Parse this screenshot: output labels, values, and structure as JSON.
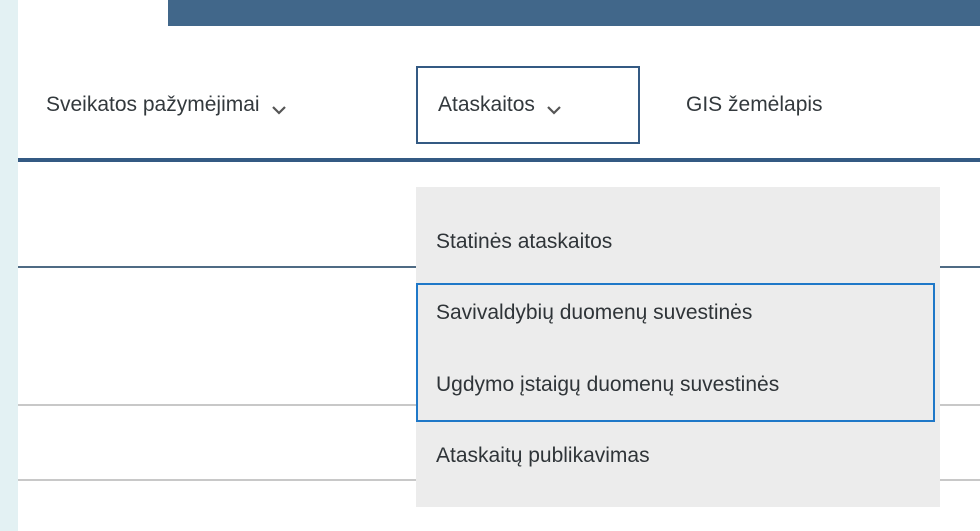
{
  "nav": {
    "items": [
      {
        "label": "Sveikatos pažymėjimai",
        "has_dropdown": true,
        "icon": "chevron-down-icon"
      },
      {
        "label": "Ataskaitos",
        "has_dropdown": true,
        "icon": "chevron-down-icon",
        "state": "open"
      },
      {
        "label": "GIS žemėlapis",
        "has_dropdown": false
      }
    ]
  },
  "dropdown": {
    "parent": "Ataskaitos",
    "items": [
      {
        "label": "Statinės ataskaitos"
      },
      {
        "label": "Savivaldybių duomenų suvestinės"
      },
      {
        "label": "Ugdymo įstaigų duomenų suvestinės"
      },
      {
        "label": "Ataskaitų publikavimas"
      }
    ]
  },
  "colors": {
    "accent": "#41678a",
    "focus_outline": "#1f78c8",
    "dropdown_bg": "#ececec",
    "page_margin": "#e3f1f3"
  }
}
